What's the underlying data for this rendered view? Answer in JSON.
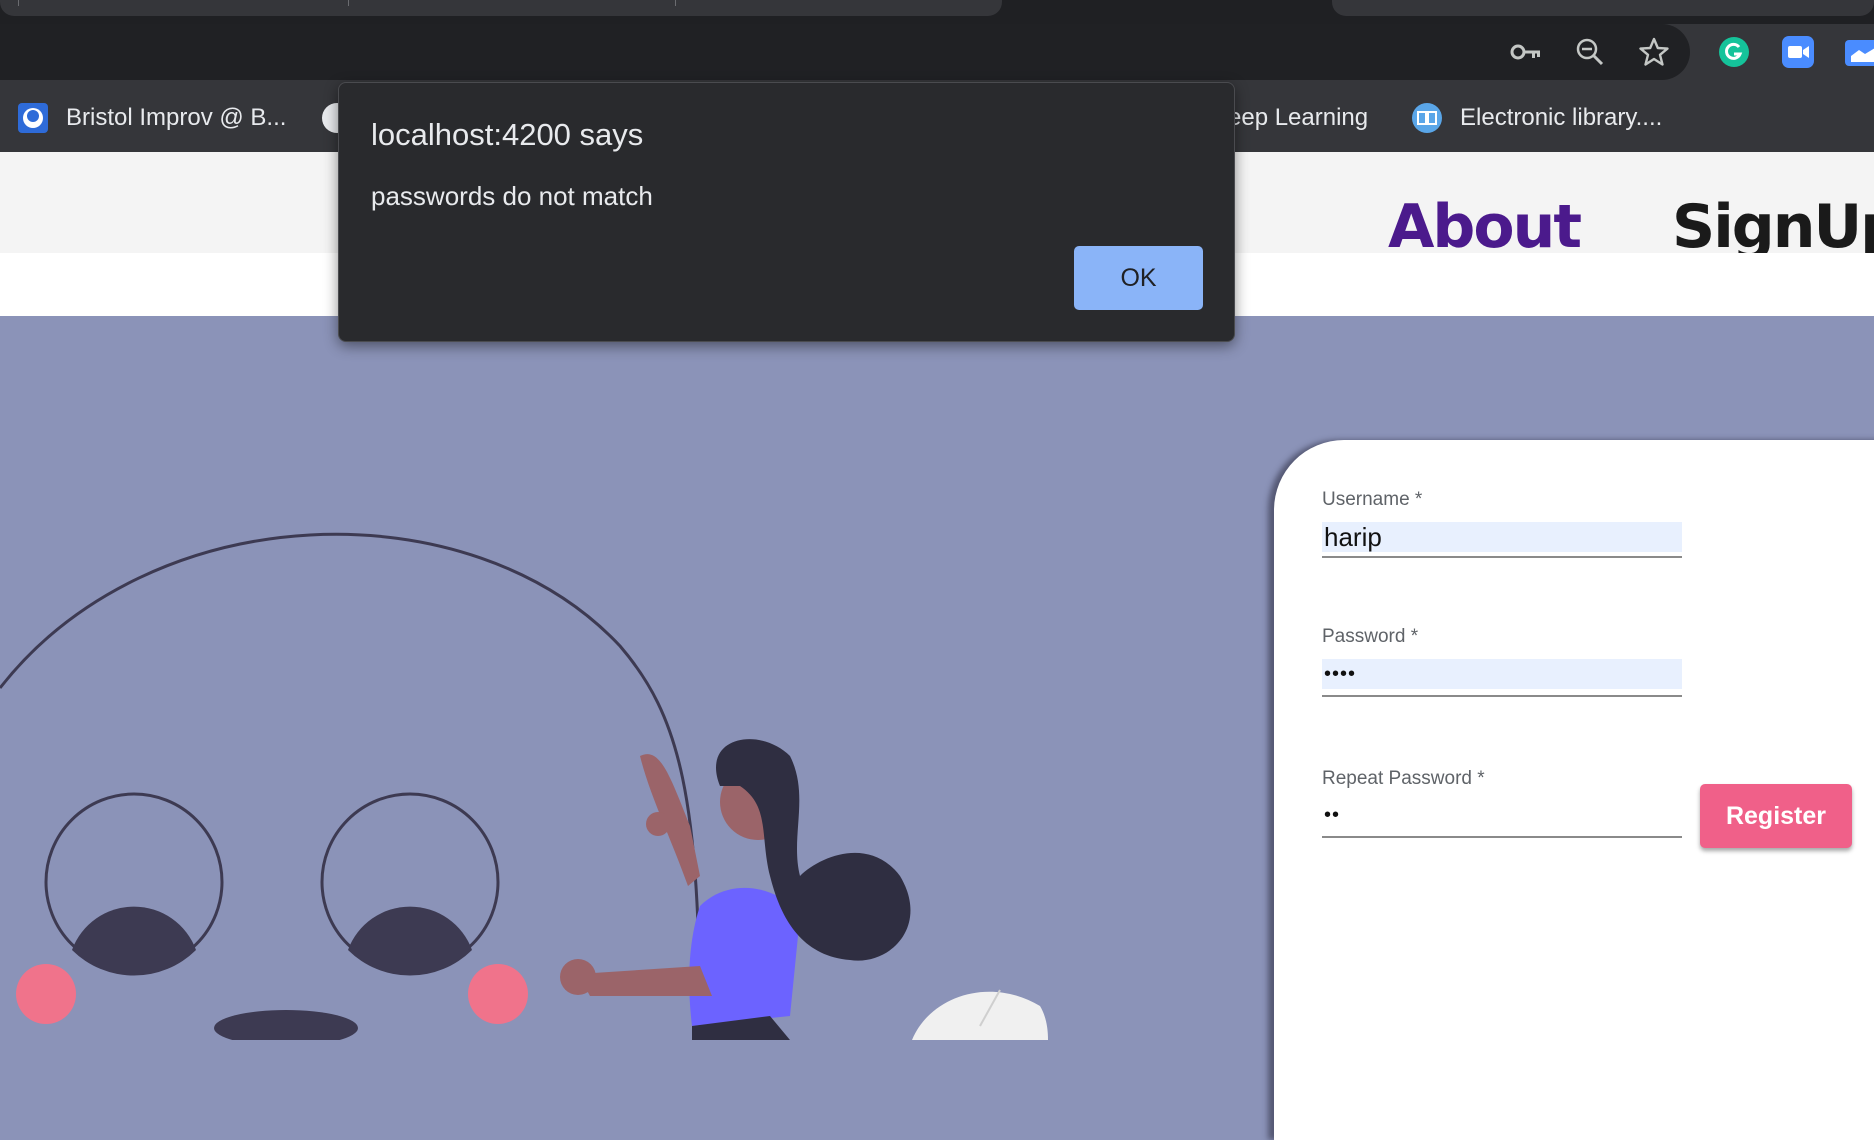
{
  "browser": {
    "bookmarks": [
      {
        "label": "Bristol Improv @ B..."
      },
      {
        "label": "eep Learning"
      },
      {
        "label": "Electronic library...."
      }
    ],
    "icons": {
      "password": "key-icon",
      "zoom": "zoom-icon",
      "bookmark": "star-icon",
      "grammarly": "grammarly-icon",
      "zoom_app": "video-camera-icon",
      "extension": "folder-icon"
    }
  },
  "site": {
    "nav": {
      "about": "About",
      "signup": "SignUp"
    },
    "colors": {
      "about": "#4b1a8c",
      "signup": "#1a1a1a",
      "hero_bg": "#8b93b8"
    }
  },
  "form": {
    "username": {
      "label": "Username *",
      "value": "harip"
    },
    "password": {
      "label": "Password *",
      "value": "••••"
    },
    "repeat_password": {
      "label": "Repeat Password *",
      "value": "••"
    },
    "register_label": "Register",
    "register_color": "#f06089"
  },
  "alert": {
    "title": "localhost:4200 says",
    "message": "passwords do not match",
    "ok_label": "OK",
    "ok_color": "#8ab4f8"
  }
}
